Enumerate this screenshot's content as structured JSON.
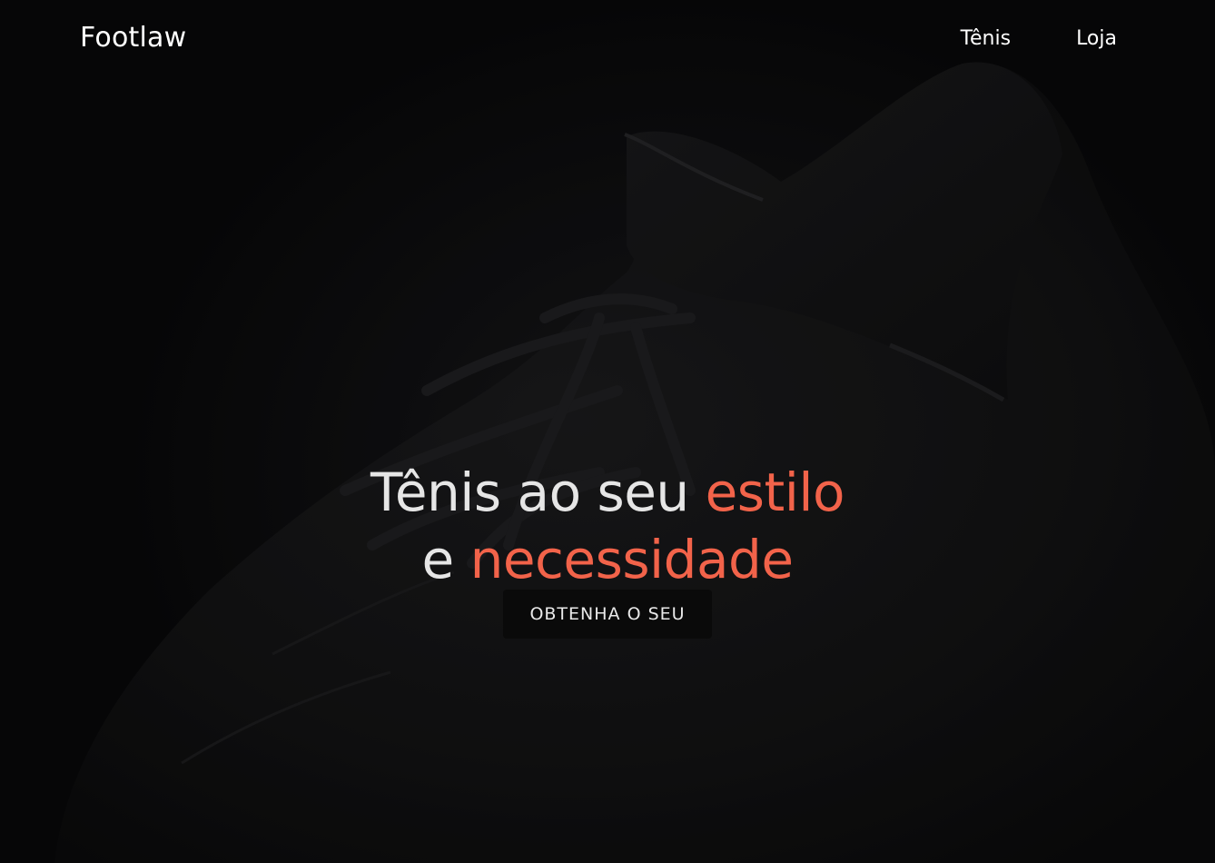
{
  "brand": {
    "name": "Footlaw"
  },
  "nav": {
    "items": [
      {
        "label": "Tênis"
      },
      {
        "label": "Loja"
      }
    ]
  },
  "hero": {
    "headline_line1_plain": "Tênis ao seu ",
    "headline_line1_accent": "estilo",
    "headline_line2_plain": "e ",
    "headline_line2_accent": "necessidade",
    "cta_label": "OBTENHA O SEU",
    "background_icon": "black-sneaker-photo"
  },
  "colors": {
    "accent": "#f2634a",
    "background": "#0c0c0d",
    "text": "#ffffff",
    "button_bg": "#0a0a0a"
  }
}
